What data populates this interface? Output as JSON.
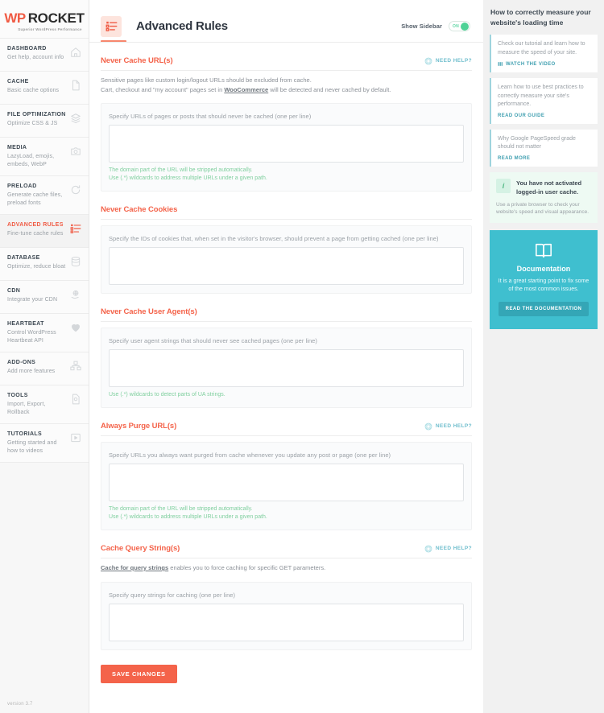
{
  "brand": {
    "wp": "WP",
    "rocket": "ROCKET",
    "tagline": "Superior WordPress Performance"
  },
  "sidebar": {
    "version": "version 3.7",
    "items": [
      {
        "title": "DASHBOARD",
        "sub": "Get help, account info",
        "icon": "home-icon",
        "active": false
      },
      {
        "title": "CACHE",
        "sub": "Basic cache options",
        "icon": "file-icon",
        "active": false
      },
      {
        "title": "FILE OPTIMIZATION",
        "sub": "Optimize CSS & JS",
        "icon": "layers-icon",
        "active": false
      },
      {
        "title": "MEDIA",
        "sub": "LazyLoad, emojis, embeds, WebP",
        "icon": "media-icon",
        "active": false
      },
      {
        "title": "PRELOAD",
        "sub": "Generate cache files, preload fonts",
        "icon": "refresh-icon",
        "active": false
      },
      {
        "title": "ADVANCED RULES",
        "sub": "Fine-tune cache rules",
        "icon": "list-icon",
        "active": true
      },
      {
        "title": "DATABASE",
        "sub": "Optimize, reduce bloat",
        "icon": "database-icon",
        "active": false
      },
      {
        "title": "CDN",
        "sub": "Integrate your CDN",
        "icon": "cdn-icon",
        "active": false
      },
      {
        "title": "HEARTBEAT",
        "sub": "Control WordPress Heartbeat API",
        "icon": "heart-icon",
        "active": false
      },
      {
        "title": "ADD-ONS",
        "sub": "Add more features",
        "icon": "addons-icon",
        "active": false
      },
      {
        "title": "TOOLS",
        "sub": "Import, Export, Rollback",
        "icon": "tools-icon",
        "active": false
      },
      {
        "title": "TUTORIALS",
        "sub": "Getting started and how to videos",
        "icon": "video-icon",
        "active": false
      }
    ]
  },
  "header": {
    "title": "Advanced Rules",
    "icon": "list-icon",
    "sidebar_toggle_label": "Show Sidebar",
    "toggle_state": "ON"
  },
  "need_help_label": "NEED HELP?",
  "sections": [
    {
      "title": "Never Cache URL(s)",
      "has_help": true,
      "desc_line1": "Sensitive pages like custom login/logout URLs should be excluded from cache.",
      "desc_line2_a": "Cart, checkout and \"my account\" pages set in ",
      "desc_link": "WooCommerce",
      "desc_line2_b": " will be detected and never cached by default.",
      "field_label": "Specify URLs of pages or posts that should never be cached (one per line)",
      "field_value": "",
      "hints": [
        "The domain part of the URL will be stripped automatically.",
        "Use (.*) wildcards to address multiple URLs under a given path."
      ]
    },
    {
      "title": "Never Cache Cookies",
      "has_help": false,
      "field_label": "Specify the IDs of cookies that, when set in the visitor's browser, should prevent a page from getting cached (one per line)",
      "field_value": "",
      "hints": []
    },
    {
      "title": "Never Cache User Agent(s)",
      "has_help": false,
      "field_label": "Specify user agent strings that should never see cached pages (one per line)",
      "field_value": "",
      "hints": [
        "Use (.*) wildcards to detect parts of UA strings."
      ]
    },
    {
      "title": "Always Purge URL(s)",
      "has_help": true,
      "field_label": "Specify URLs you always want purged from cache whenever you update any post or page (one per line)",
      "field_value": "",
      "hints": [
        "The domain part of the URL will be stripped automatically.",
        "Use (.*) wildcards to address multiple URLs under a given path."
      ]
    },
    {
      "title": "Cache Query String(s)",
      "has_help": true,
      "desc_link": "Cache for query strings",
      "desc_after": " enables you to force caching for specific GET parameters.",
      "field_label": "Specify query strings for caching (one per line)",
      "field_value": "",
      "hints": []
    }
  ],
  "save_label": "SAVE CHANGES",
  "aside": {
    "title": "How to correctly measure your website's loading time",
    "cards": [
      {
        "text": "Check our tutorial and learn how to measure the speed of your site.",
        "link": "WATCH THE VIDEO",
        "icon": "video-play-icon"
      },
      {
        "text": "Learn how to use best practices to correctly measure your site's performance.",
        "link": "READ OUR GUIDE",
        "icon": ""
      },
      {
        "text": "Why Google PageSpeed grade should not matter",
        "link": "READ MORE",
        "icon": ""
      }
    ],
    "notice": {
      "badge": "i",
      "title": "You have not activated logged-in user cache.",
      "sub": "Use a private browser to check your website's speed and visual appearance."
    },
    "doc": {
      "icon": "book-icon",
      "title": "Documentation",
      "text": "It is a great starting point to fix some of the most common issues.",
      "button": "READ THE DOCUMENTATION"
    }
  },
  "colors": {
    "brand_orange": "#f05b44",
    "section_title": "#f4634a",
    "hint_green": "#7fcf9e",
    "help_teal": "#6fbecd",
    "doc_bg": "#3fbfcf",
    "toggle_green": "#4ed296"
  }
}
